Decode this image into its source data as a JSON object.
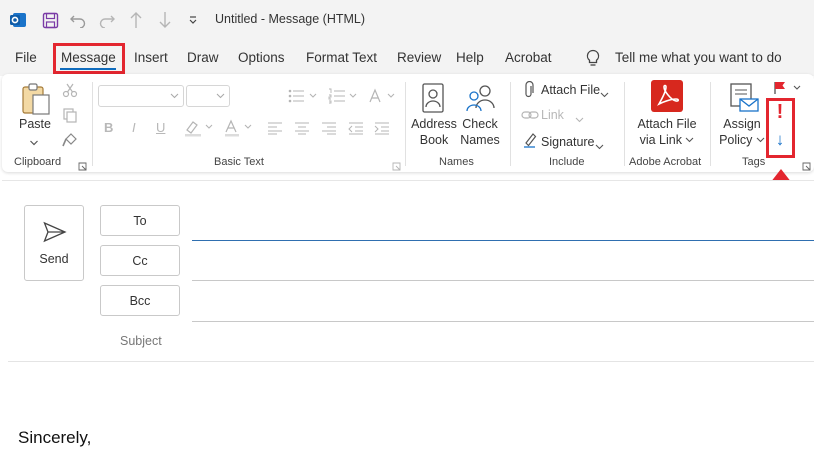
{
  "window": {
    "title": "Untitled  -  Message (HTML)"
  },
  "menu": {
    "tabs": [
      "File",
      "Message",
      "Insert",
      "Draw",
      "Options",
      "Format Text",
      "Review",
      "Help",
      "Acrobat"
    ],
    "active": "Message",
    "tell_me": "Tell me what you want to do"
  },
  "ribbon": {
    "groups": {
      "clipboard": "Clipboard",
      "basic_text": "Basic Text",
      "names": "Names",
      "include": "Include",
      "adobe": "Adobe Acrobat",
      "tags": "Tags"
    },
    "buttons": {
      "paste": "Paste",
      "address_book_1": "Address",
      "address_book_2": "Book",
      "check_names_1": "Check",
      "check_names_2": "Names",
      "attach_file": "Attach File",
      "link": "Link",
      "signature": "Signature",
      "attach_via_link_1": "Attach File",
      "attach_via_link_2": "via Link",
      "assign_policy_1": "Assign",
      "assign_policy_2": "Policy"
    },
    "format": {
      "bold": "B",
      "italic": "I",
      "underline": "U"
    },
    "tags": {
      "high_importance": "!",
      "low_importance": "↓"
    }
  },
  "compose": {
    "send": "Send",
    "to": "To",
    "cc": "Cc",
    "bcc": "Bcc",
    "subject": "Subject",
    "body": "Sincerely,"
  },
  "colors": {
    "accent": "#0f6cbd",
    "highlight_red": "#e3262f",
    "adobe_red": "#d7281e"
  }
}
